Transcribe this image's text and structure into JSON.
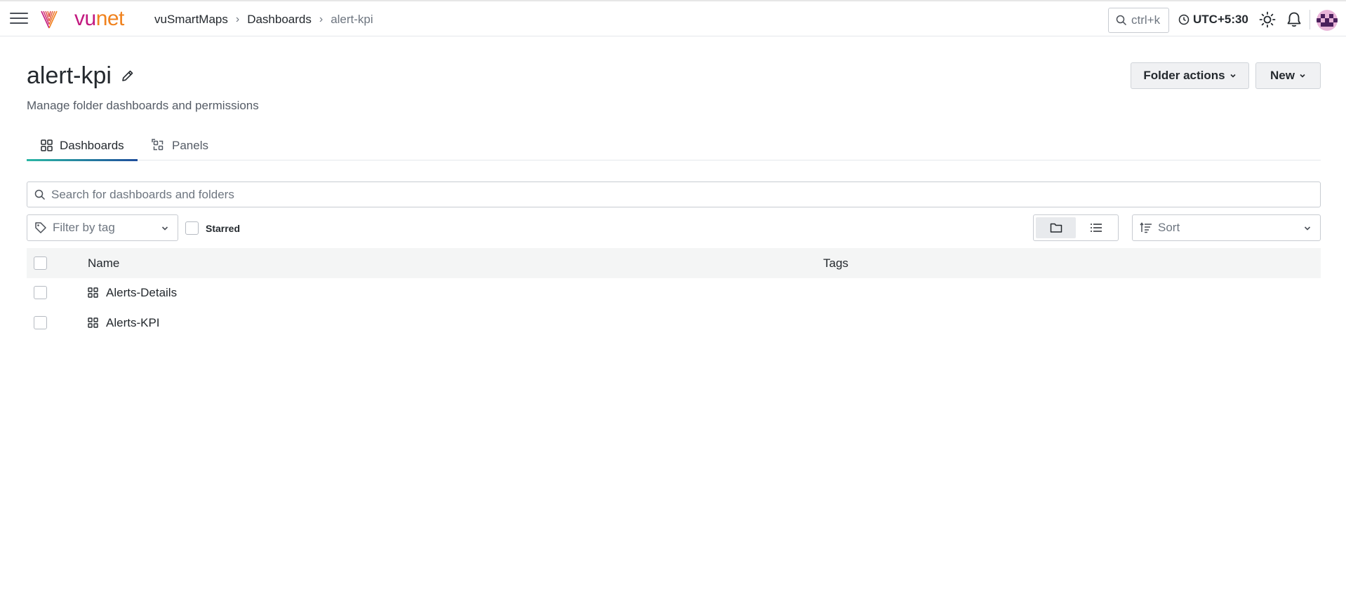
{
  "header": {
    "logo_text_vu": "vu",
    "logo_text_net": "net",
    "breadcrumb": [
      "vuSmartMaps",
      "Dashboards",
      "alert-kpi"
    ],
    "search_shortcut": "ctrl+k",
    "timezone": "UTC+5:30",
    "icons": [
      "hamburger-icon",
      "search-icon",
      "clock-icon",
      "sun-icon",
      "bell-icon",
      "avatar"
    ]
  },
  "page": {
    "title": "alert-kpi",
    "subtitle": "Manage folder dashboards and permissions",
    "folder_actions_label": "Folder actions",
    "new_label": "New"
  },
  "tabs": [
    {
      "label": "Dashboards",
      "icon": "apps-icon",
      "active": true
    },
    {
      "label": "Panels",
      "icon": "library-panel-icon",
      "active": false
    }
  ],
  "search": {
    "placeholder": "Search for dashboards and folders"
  },
  "filters": {
    "tag_placeholder": "Filter by tag",
    "starred_label": "Starred",
    "sort_placeholder": "Sort",
    "view_mode": "folder"
  },
  "table": {
    "columns": [
      "Name",
      "Tags"
    ],
    "rows": [
      {
        "name": "Alerts-Details",
        "type": "dashboard"
      },
      {
        "name": "Alerts-KPI",
        "type": "dashboard"
      }
    ]
  },
  "colors": {
    "brand_magenta": "#c2187f",
    "brand_orange": "#f0821e",
    "tab_underline_start": "#2bb7a4",
    "tab_underline_end": "#1f4e9c"
  }
}
